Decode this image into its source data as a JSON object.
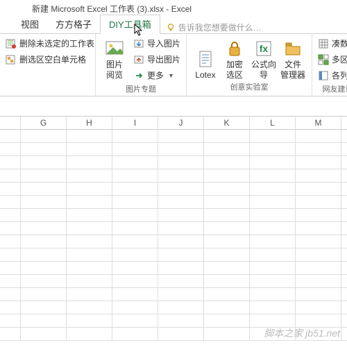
{
  "title": "新建 Microsoft Excel 工作表 (3).xlsx - Excel",
  "tabs": {
    "t0": "视图",
    "t1": "方方格子",
    "t2": "DIY工具箱"
  },
  "tellme": "告诉我您想要做什么…",
  "g1": {
    "btn1": "删除未选定的工作表",
    "btn2": "删选区空白单元格"
  },
  "g2": {
    "big": "图片\n阅览",
    "b1": "导入图片",
    "b2": "导出图片",
    "b3": "更多",
    "label": "图片专题"
  },
  "g3": {
    "big": "Lotex",
    "b1": "加密\n选区",
    "b2": "公式向\n导",
    "b3": "文件\n管理器",
    "label": "创意实验室"
  },
  "g4": {
    "b1": "凑数",
    "b2": "多区域汇",
    "b3": "各列累计",
    "label": "网友建议直"
  },
  "cols": [
    "G",
    "H",
    "I",
    "J",
    "K",
    "L",
    "M"
  ],
  "watermark": "脚本之家 jb51.net"
}
